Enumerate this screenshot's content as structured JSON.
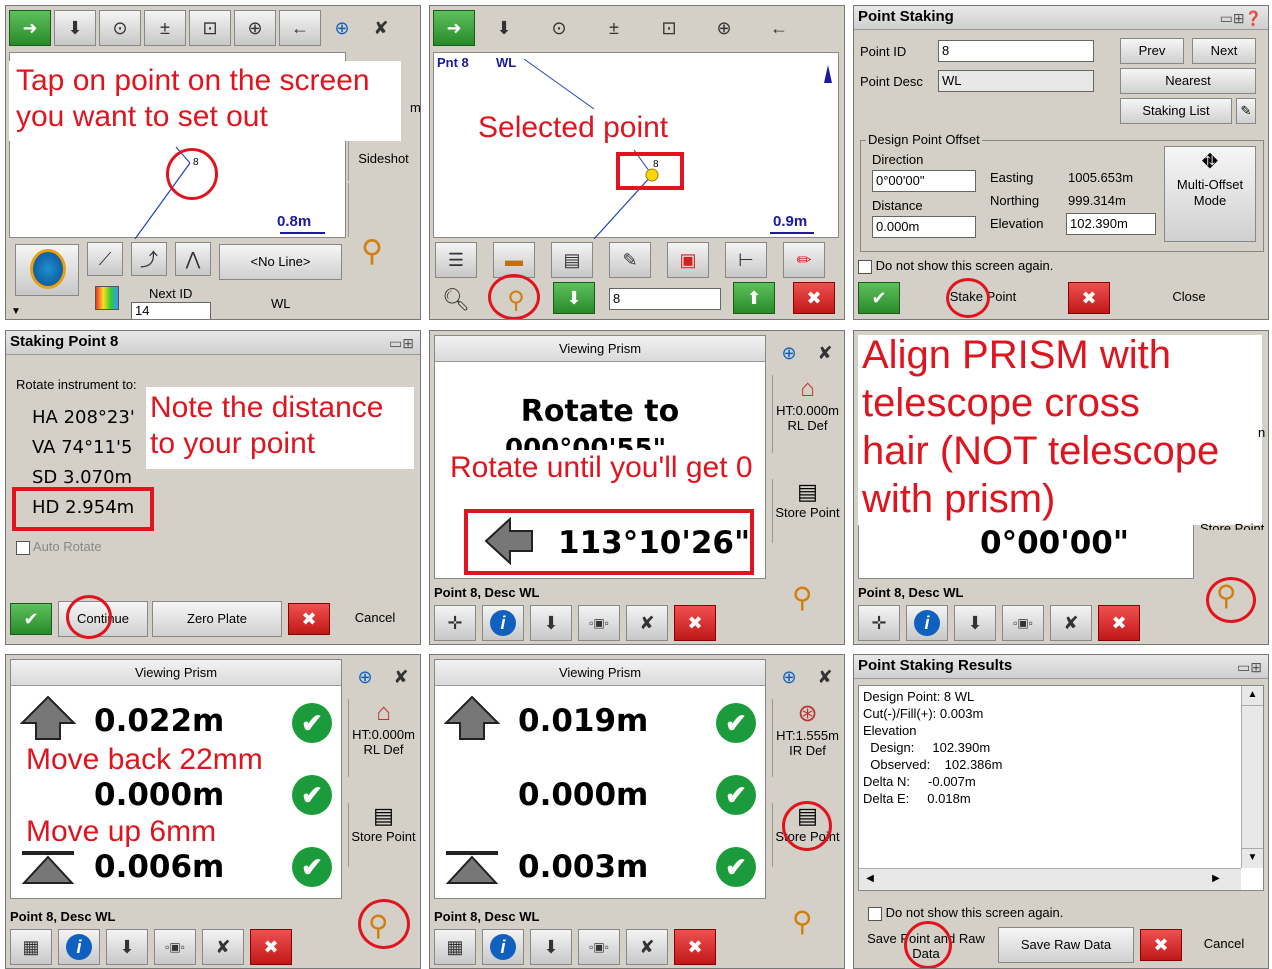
{
  "p1": {
    "annotation_line1": "Tap on point on the screen",
    "annotation_line2": "you want to set out",
    "partial_right": "m",
    "sideshot": "Sideshot",
    "pt_label": "8",
    "scale": "0.8m",
    "no_line": "<No Line>",
    "next_id_label": "Next ID",
    "next_id_value": "14",
    "desc_value": "WL"
  },
  "p2": {
    "header_pnt": "Pnt 8",
    "header_wl": "WL",
    "annotation": "Selected point",
    "pt_label": "8",
    "scale": "0.9m",
    "input_value": "8"
  },
  "p3": {
    "title": "Point Staking",
    "point_id_label": "Point ID",
    "point_id_value": "8",
    "point_desc_label": "Point Desc",
    "point_desc_value": "WL",
    "prev": "Prev",
    "next": "Next",
    "nearest": "Nearest",
    "staking_list": "Staking List",
    "offset_group": "Design Point Offset",
    "direction_label": "Direction",
    "direction_value": "0°00'00\"",
    "distance_label": "Distance",
    "distance_value": "0.000m",
    "easting_label": "Easting",
    "easting_value": "1005.653m",
    "northing_label": "Northing",
    "northing_value": "999.314m",
    "elevation_label": "Elevation",
    "elevation_value": "102.390m",
    "multi_offset_1": "Multi-Offset",
    "multi_offset_2": "Mode",
    "dont_show": "Do not show this screen again.",
    "stake_point": "Stake Point",
    "close": "Close"
  },
  "p4": {
    "title": "Staking Point 8",
    "rotate_text": "Rotate instrument to:",
    "ha": "HA  208°23'",
    "va": "VA  74°11'5",
    "sd": "SD  3.070m",
    "hd": "HD  2.954m",
    "auto_rotate": "Auto Rotate",
    "annotation_line1": "Note the distance",
    "annotation_line2": "to your point",
    "continue": "Continue",
    "zero_plate": "Zero Plate",
    "cancel": "Cancel"
  },
  "p5": {
    "header": "Viewing Prism",
    "rotate_to": "Rotate to",
    "partial": "000°00'55\"",
    "annotation": "Rotate until you'll get 0",
    "angle": "113°10'26\"",
    "ht_1": "HT:0.000m",
    "ht_2": "RL Def",
    "store_point": "Store Point",
    "footer": "Point 8, Desc WL"
  },
  "p6": {
    "annotation_line1": "Align PRISM with",
    "annotation_line2": "telescope cross",
    "annotation_line3": "hair (NOT telescope",
    "annotation_line4": "with prism)",
    "angle": "0°00'00\"",
    "partial": "n",
    "partial2": "Store Point",
    "footer": "Point 8, Desc WL"
  },
  "p7": {
    "header": "Viewing Prism",
    "v1": "0.022m",
    "v2": "0.000m",
    "v3": "0.006m",
    "annotation1": "Move back 22mm",
    "annotation2": "Move up 6mm",
    "ht_1": "HT:0.000m",
    "ht_2": "RL Def",
    "store_point": "Store Point",
    "footer": "Point 8, Desc WL"
  },
  "p8": {
    "header": "Viewing Prism",
    "v1": "0.019m",
    "v2": "0.000m",
    "v3": "0.003m",
    "ht_1": "HT:1.555m",
    "ht_2": "IR Def",
    "store_point": "Store Point",
    "footer": "Point 8, Desc WL"
  },
  "p9": {
    "title": "Point Staking Results",
    "design_point": "Design Point:  8 WL",
    "cutfill": "Cut(-)/Fill(+): 0.003m",
    "elevation": "Elevation",
    "design": "  Design:     102.390m",
    "observed": "  Observed:    102.386m",
    "delta_n": "Delta N:     -0.007m",
    "delta_e": "Delta E:     0.018m",
    "dont_show": "Do not show this screen again.",
    "save_point_1": "Save Point and Raw",
    "save_point_2": "Data",
    "save_raw": "Save Raw Data",
    "cancel": "Cancel"
  },
  "icons": {
    "check": "check-icon",
    "cancel": "close-icon",
    "info": "info-icon"
  }
}
